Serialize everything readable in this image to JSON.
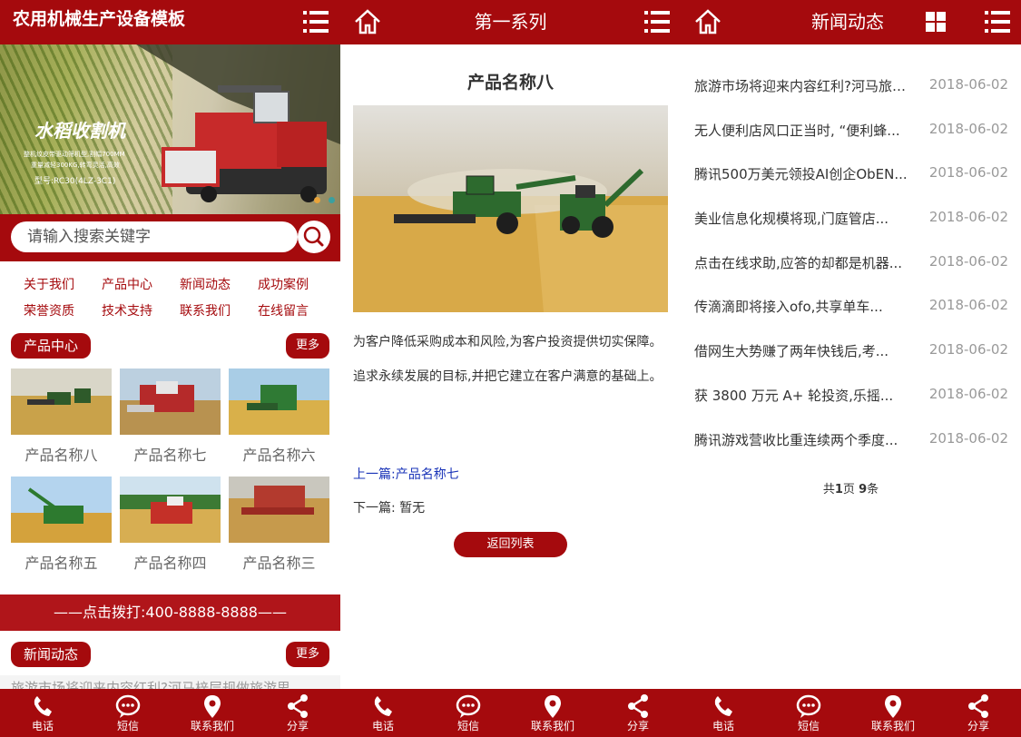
{
  "home": {
    "title": "农用机械生产设备模板",
    "banner": {
      "headline": "水稻收割机",
      "subline1": "整机纹皮带驱动筛机型,割幅700MM",
      "subline2": "重量减轻300KG,转弯灵活,高效",
      "model": "型号:RC30(4LZ-3C1)"
    },
    "search": {
      "placeholder": "请输入搜索关键字"
    },
    "nav": [
      "关于我们",
      "产品中心",
      "新闻动态",
      "成功案例",
      "荣誉资质",
      "技术支持",
      "联系我们",
      "在线留言"
    ],
    "product_section": {
      "title": "产品中心",
      "more": "更多"
    },
    "products": [
      "产品名称八",
      "产品名称七",
      "产品名称六",
      "产品名称五",
      "产品名称四",
      "产品名称三"
    ],
    "call": "——点击拨打:400-8888-8888——",
    "news_section": {
      "title": "新闻动态",
      "more": "更多"
    },
    "news_peek": "旅游市场将迎来内容红利?河马梓层规做旅游思"
  },
  "detail": {
    "header_title": "第一系列",
    "product_title": "产品名称八",
    "description": "为客户降低采购成本和风险,为客户投资提供切实保障。 追求永续发展的目标,并把它建立在客户满意的基础上。",
    "prev": "上一篇:产品名称七",
    "next": "下一篇: 暂无",
    "back": "返回列表"
  },
  "news": {
    "header_title": "新闻动态",
    "items": [
      {
        "title": "旅游市场将迎来内容红利?河马旅游...",
        "date": "2018-06-02"
      },
      {
        "title": "无人便利店风口正当时, “便利蜂...",
        "date": "2018-06-02"
      },
      {
        "title": "腾讯500万美元领投AI创企ObEN...",
        "date": "2018-06-02"
      },
      {
        "title": "美业信息化规模将现,门庭管店...",
        "date": "2018-06-02"
      },
      {
        "title": "点击在线求助,应答的却都是机器...",
        "date": "2018-06-02"
      },
      {
        "title": "传滴滴即将接入ofo,共享单车...",
        "date": "2018-06-02"
      },
      {
        "title": "借网生大势赚了两年快钱后,考...",
        "date": "2018-06-02"
      },
      {
        "title": "获 3800 万元 A+ 轮投资,乐摇...",
        "date": "2018-06-02"
      },
      {
        "title": "腾讯游戏营收比重连续两个季度...",
        "date": "2018-06-02"
      }
    ],
    "pager": {
      "prefix": "共",
      "pages": "1",
      "mid": "页 ",
      "count": "9",
      "suffix": "条"
    }
  },
  "bottom_nav": [
    {
      "label": "电话",
      "icon": "phone-icon"
    },
    {
      "label": "短信",
      "icon": "sms-icon"
    },
    {
      "label": "联系我们",
      "icon": "location-icon"
    },
    {
      "label": "分享",
      "icon": "share-icon"
    }
  ],
  "colors": {
    "brand": "#a50a0d",
    "call_bar": "#b0151a",
    "link_blue": "#1a34b8"
  }
}
